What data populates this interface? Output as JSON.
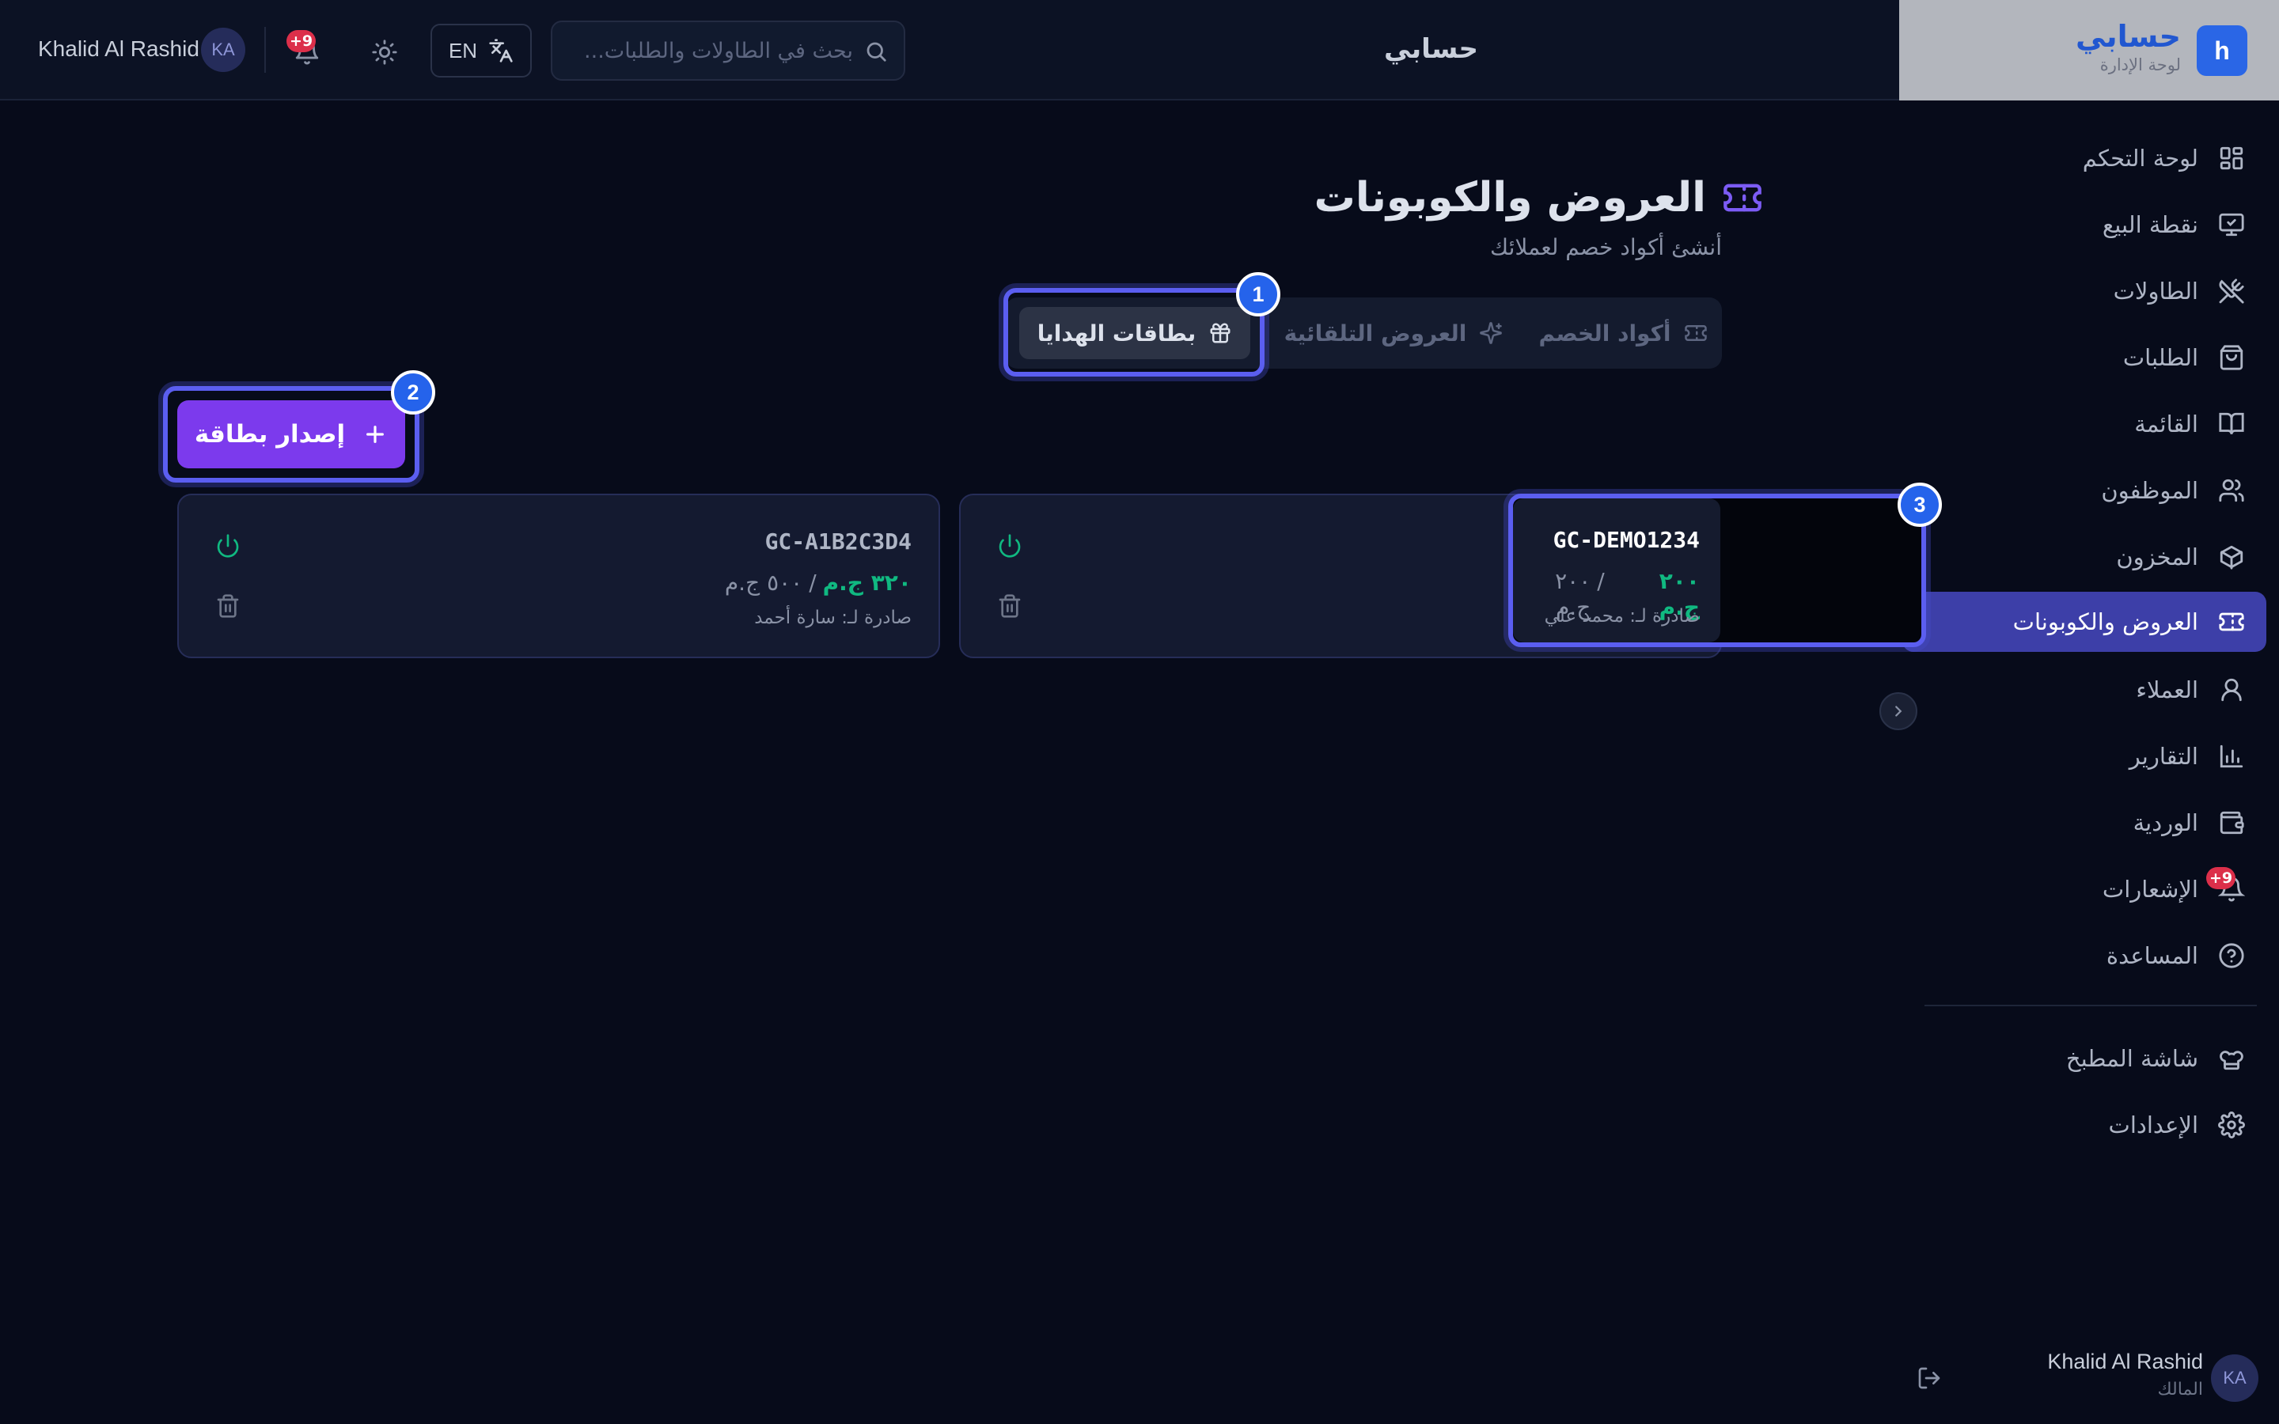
{
  "header": {
    "user_name": "Khalid Al Rashid",
    "user_initials": "KA",
    "notifications_badge": "+9",
    "language_label": "EN",
    "search_placeholder": "بحث في الطاولات والطلبات...",
    "page_header_title": "حسابي"
  },
  "brand": {
    "logo_letter": "h",
    "title": "حسابي",
    "subtitle": "لوحة الإدارة"
  },
  "sidebar": {
    "items": [
      {
        "label": "لوحة التحكم",
        "icon": "dashboard-grid-icon"
      },
      {
        "label": "نقطة البيع",
        "icon": "monitor-icon"
      },
      {
        "label": "الطاولات",
        "icon": "utensils-icon"
      },
      {
        "label": "الطلبات",
        "icon": "shopping-bag-icon"
      },
      {
        "label": "القائمة",
        "icon": "book-icon"
      },
      {
        "label": "الموظفون",
        "icon": "users-icon"
      },
      {
        "label": "المخزون",
        "icon": "package-icon"
      },
      {
        "label": "العروض والكوبونات",
        "icon": "ticket-icon",
        "active": true
      },
      {
        "label": "العملاء",
        "icon": "user-icon"
      },
      {
        "label": "التقارير",
        "icon": "bar-chart-icon"
      },
      {
        "label": "الوردية",
        "icon": "wallet-icon"
      },
      {
        "label": "الإشعارات",
        "icon": "bell-icon",
        "badge": "+9"
      },
      {
        "label": "المساعدة",
        "icon": "help-circle-icon"
      }
    ],
    "bottom_items": [
      {
        "label": "شاشة المطبخ",
        "icon": "chef-hat-icon"
      },
      {
        "label": "الإعدادات",
        "icon": "settings-icon"
      }
    ],
    "user_name": "Khalid Al Rashid",
    "user_role": "المالك",
    "user_initials": "KA"
  },
  "main": {
    "title": "العروض والكوبونات",
    "subtitle": "أنشئ أكواد خصم لعملائك",
    "tabs": [
      {
        "label": "أكواد الخصم",
        "icon": "ticket-icon"
      },
      {
        "label": "العروض التلقائية",
        "icon": "sparkles-icon"
      },
      {
        "label": "بطاقات الهدايا",
        "icon": "gift-icon",
        "active": true
      }
    ],
    "issue_button": "إصدار بطاقة",
    "cards": [
      {
        "code": "GC-DEMO1234",
        "remaining": "٢٠٠ ج.م",
        "separator": "/",
        "total": "٢٠٠ ج.م",
        "issued_to": "صادرة لـ: محمد علي"
      },
      {
        "code": "GC-A1B2C3D4",
        "remaining": "٣٢٠ ج.م",
        "separator": "/",
        "total": "٥٠٠ ج.م",
        "issued_to": "صادرة لـ: سارة أحمد"
      }
    ]
  },
  "markers": [
    "1",
    "2",
    "3"
  ],
  "colors": {
    "accent": "#5b5ef0",
    "primary_button": "#7c3aed",
    "active_nav": "#3d3fa8",
    "success": "#10b981",
    "badge": "#dc2f4a",
    "background": "#070b1a"
  }
}
